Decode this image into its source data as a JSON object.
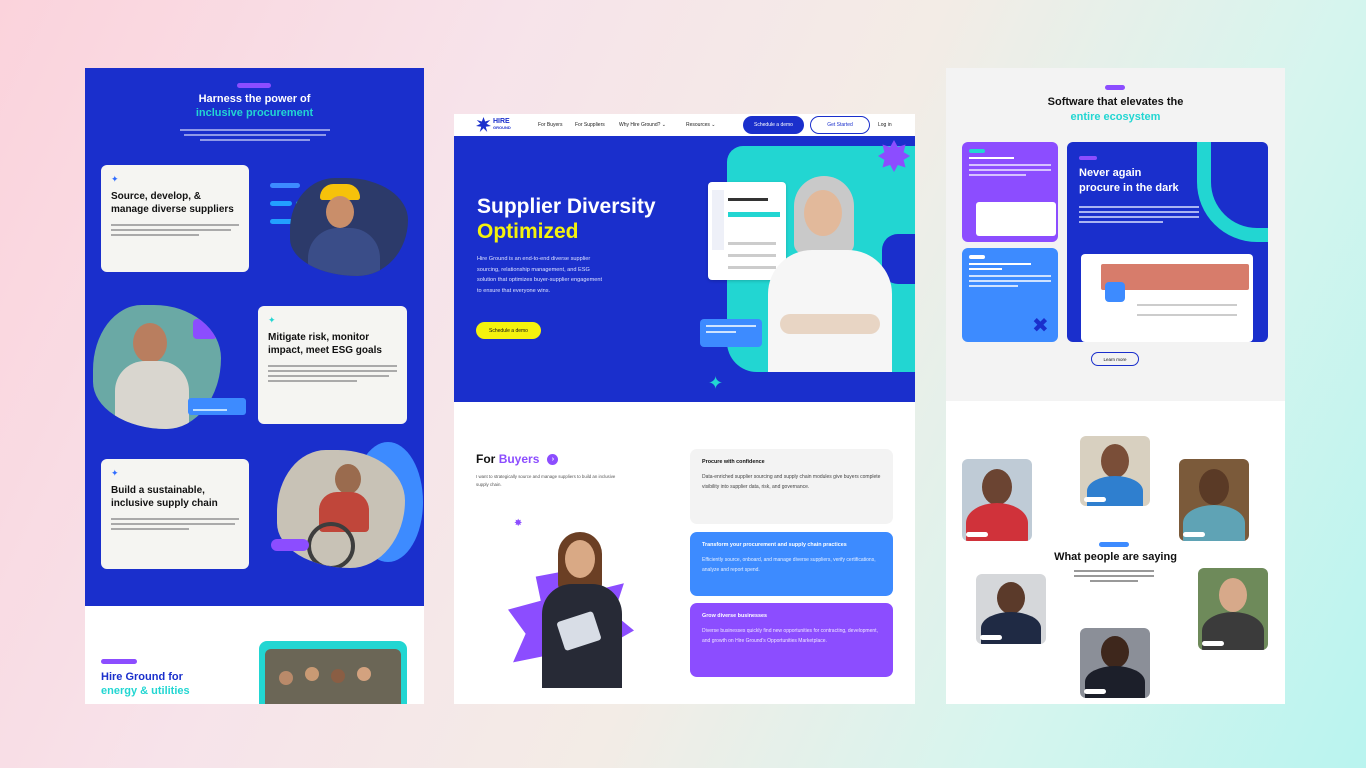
{
  "left": {
    "badge": "",
    "heading_line1": "Harness the power of",
    "heading_line2": "inclusive procurement",
    "cards": [
      {
        "title": "Source, develop, & manage diverse suppliers"
      },
      {
        "title": "Mitigate risk, monitor impact, meet ESG goals"
      },
      {
        "title": "Build a sustainable, inclusive supply chain"
      }
    ],
    "bottom_heading_line1": "Hire Ground for",
    "bottom_heading_line2": "energy & utilities"
  },
  "middle": {
    "logo_line1": "HIRE",
    "logo_line2": "GROUND",
    "nav": {
      "for_buyers": "For Buyers",
      "for_suppliers": "For Suppliers",
      "why": "Why Hire Ground?",
      "resources": "Resources",
      "schedule": "Schedule a demo",
      "get_started": "Get Started",
      "login": "Log in"
    },
    "hero": {
      "title_line1": "Supplier Diversity",
      "title_line2": "Optimized",
      "description": "Hire Ground is an end-to-end diverse supplier sourcing, relationship management, and ESG solution that optimizes buyer-supplier engagement to ensure that everyone wins.",
      "cta": "Schedule a demo"
    },
    "for_buyers": {
      "prefix": "For",
      "highlight": "Buyers",
      "subtitle": "I want to strategically source and manage suppliers to build an inclusive supply chain."
    },
    "cards": [
      {
        "title": "Procure with confidence",
        "body": "Data-enriched supplier sourcing and supply chain modules give buyers complete visibility into supplier data, risk, and governance."
      },
      {
        "title": "Transform your procurement and supply chain practices",
        "body": "Efficiently source, onboard, and manage diverse suppliers, verify certifications, analyze and report spend."
      },
      {
        "title": "Grow diverse businesses",
        "body": "Diverse businesses quickly find new opportunities for contracting, development, and growth on Hire Ground's Opportunities Marketplace."
      }
    ]
  },
  "right": {
    "heading_line1": "Software that elevates the",
    "heading_line2": "entire ecosystem",
    "dark_card_line1": "Never again",
    "dark_card_line2": "procure in the dark",
    "learn_more": "Learn more",
    "testimonials_heading": "What people are saying"
  },
  "colors": {
    "blue": "#1a2fcc",
    "cyan": "#22d6d2",
    "purple": "#8c4dff",
    "yellow": "#f4f20d",
    "light_blue": "#3d8bff"
  }
}
